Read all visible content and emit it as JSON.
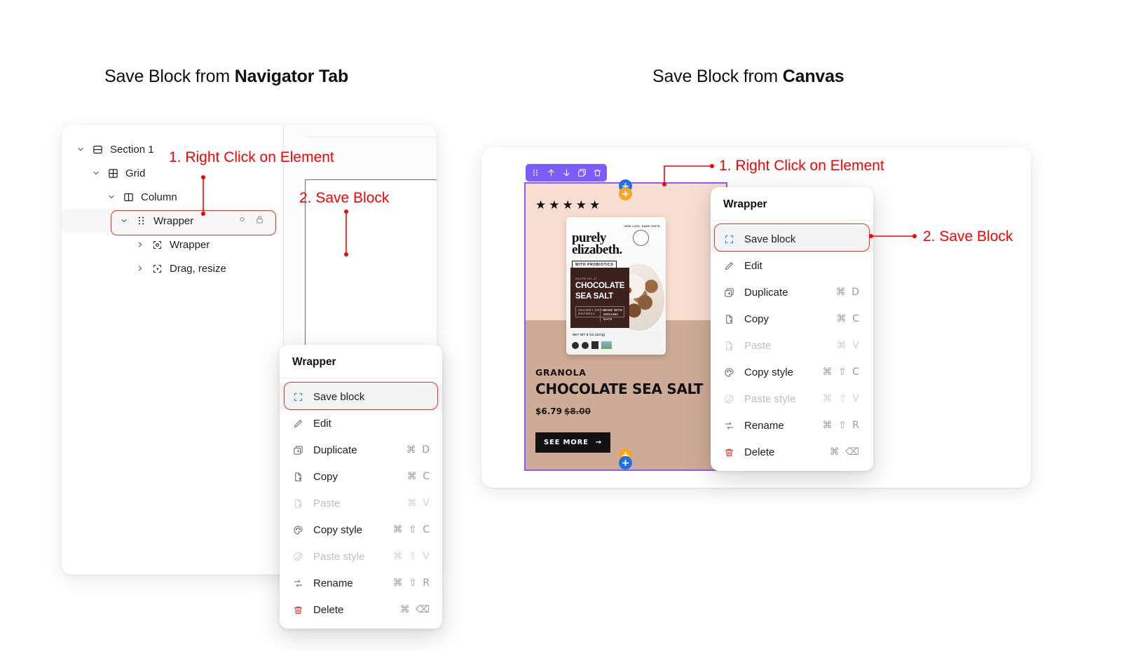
{
  "headings": {
    "left_prefix": "Save Block from ",
    "left_bold": "Navigator Tab",
    "right_prefix": "Save Block from ",
    "right_bold": "Canvas"
  },
  "annotations": {
    "left_step1": "1. Right Click on Element",
    "left_step2": "2. Save Block",
    "right_step1": "1. Right Click on Element",
    "right_step2": "2. Save Block",
    "color": "#ff0000"
  },
  "navigator": {
    "rows": [
      {
        "label": "Section 1",
        "icon": "section-icon",
        "chevron": "down",
        "level": 0,
        "selected": false
      },
      {
        "label": "Grid",
        "icon": "grid-icon",
        "chevron": "down",
        "level": 1,
        "selected": false
      },
      {
        "label": "Column",
        "icon": "column-icon",
        "chevron": "down",
        "level": 2,
        "selected": false
      },
      {
        "label": "Wrapper",
        "icon": "drag-dots-icon",
        "chevron": "down",
        "level": 3,
        "selected": true
      },
      {
        "label": "Wrapper",
        "icon": "component-icon",
        "chevron": "right",
        "level": 4,
        "selected": false
      },
      {
        "label": "Drag, resize",
        "icon": "interaction-icon",
        "chevron": "right",
        "level": 4,
        "selected": false
      }
    ]
  },
  "context_menu": {
    "title": "Wrapper",
    "items": [
      {
        "label": "Save block",
        "icon": "save-block-icon",
        "shortcut": "",
        "disabled": false,
        "active": true,
        "variant": "saveblock"
      },
      {
        "label": "Edit",
        "icon": "pencil-icon",
        "shortcut": "",
        "disabled": false,
        "active": false,
        "variant": ""
      },
      {
        "label": "Duplicate",
        "icon": "duplicate-icon",
        "shortcut": "⌘ D",
        "disabled": false,
        "active": false,
        "variant": ""
      },
      {
        "label": "Copy",
        "icon": "copy-icon",
        "shortcut": "⌘ C",
        "disabled": false,
        "active": false,
        "variant": ""
      },
      {
        "label": "Paste",
        "icon": "paste-icon",
        "shortcut": "⌘ V",
        "disabled": true,
        "active": false,
        "variant": ""
      },
      {
        "label": "Copy style",
        "icon": "palette-icon",
        "shortcut": "⌘ ⇧ C",
        "disabled": false,
        "active": false,
        "variant": ""
      },
      {
        "label": "Paste style",
        "icon": "palette-slash-icon",
        "shortcut": "⌘ ⇧ V",
        "disabled": true,
        "active": false,
        "variant": ""
      },
      {
        "label": "Rename",
        "icon": "rename-icon",
        "shortcut": "⌘ ⇧ R",
        "disabled": false,
        "active": false,
        "variant": ""
      },
      {
        "label": "Delete",
        "icon": "trash-icon",
        "shortcut": "⌘ ⌫",
        "disabled": false,
        "active": false,
        "variant": "danger"
      }
    ]
  },
  "canvas": {
    "toolbar": {
      "buttons": [
        {
          "name": "drag-handle-icon"
        },
        {
          "name": "move-up-icon"
        },
        {
          "name": "move-down-icon"
        },
        {
          "name": "duplicate-icon"
        },
        {
          "name": "trash-icon"
        }
      ],
      "color": "#7c5cfa"
    },
    "handles": [
      {
        "name": "add-above-blue",
        "label": "+",
        "color": "#1f6feb"
      },
      {
        "name": "add-above-orange",
        "label": "+",
        "color": "#f5a623"
      },
      {
        "name": "add-below-orange",
        "label": "+",
        "color": "#f5a623"
      },
      {
        "name": "add-below-blue",
        "label": "+",
        "color": "#1f6feb"
      }
    ],
    "selection_color": "#8b5cf6",
    "product": {
      "rating_stars": "★★★★★",
      "eyebrow": "GRANOLA",
      "name": "CHOCOLATE SEA SALT",
      "price": "$6.79",
      "compare_at_price": "$8.00",
      "button_label": "SEE MORE",
      "button_arrow": "→",
      "packaging": {
        "new_look": "NEW LOOK,\nSAME TASTE.",
        "brand_line1": "purely",
        "brand_line2": "elizabeth.",
        "probiotics_tag": "WITH PROBIOTICS",
        "recipe_no": "RECIPE NO. 47",
        "flavor_line1": "CHOCOLATE",
        "flavor_line2": "SEA SALT",
        "subtitle": "ANCIENT GRAIN GRANOLA",
        "organic_oats": "MADE WITH\nORGANIC OATS",
        "net_weight": "NET WT 8 OZ (227g)"
      },
      "bg_top_color": "#f8ded0",
      "bg_bottom_color": "#ceab96"
    }
  }
}
